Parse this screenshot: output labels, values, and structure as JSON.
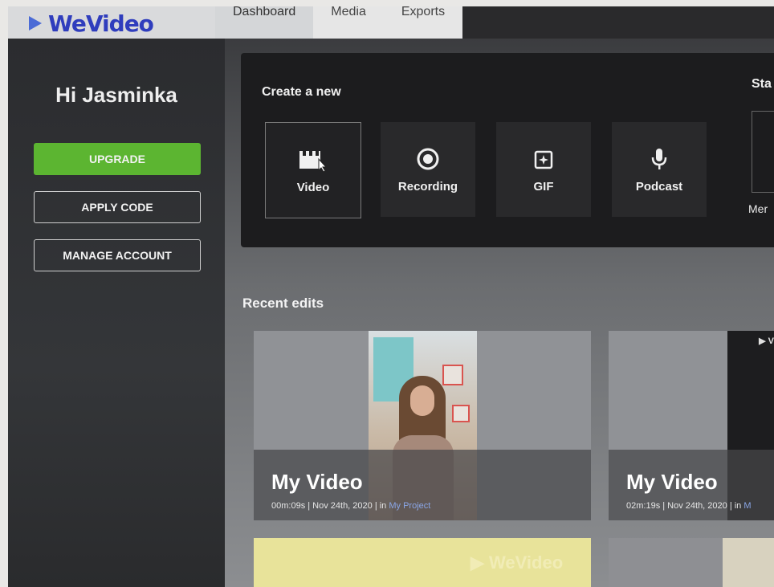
{
  "brand": {
    "logo_text": "WeVideo",
    "accent": "#5cb531",
    "logo_color": "#2f3dbd"
  },
  "tabs": [
    {
      "label": "Dashboard",
      "active": true
    },
    {
      "label": "Media",
      "active": false
    },
    {
      "label": "Exports",
      "active": false
    }
  ],
  "sidebar": {
    "greeting": "Hi Jasminka",
    "upgrade_label": "UPGRADE",
    "apply_code_label": "APPLY CODE",
    "manage_account_label": "MANAGE ACCOUNT"
  },
  "create": {
    "title": "Create a new",
    "start_title": "Sta",
    "items": [
      {
        "label": "Video",
        "icon": "clapperboard-icon"
      },
      {
        "label": "Recording",
        "icon": "record-icon"
      },
      {
        "label": "GIF",
        "icon": "gif-sparkle-icon"
      },
      {
        "label": "Podcast",
        "icon": "microphone-icon"
      }
    ],
    "extra_label": "Mer"
  },
  "recent": {
    "title": "Recent edits",
    "items": [
      {
        "title": "My Video",
        "meta": "00m:09s | Nov 24th, 2020 | in ",
        "project": "My Project"
      },
      {
        "title": "My Video",
        "meta": "02m:19s | Nov 24th, 2020 | in ",
        "project": "M"
      }
    ]
  }
}
